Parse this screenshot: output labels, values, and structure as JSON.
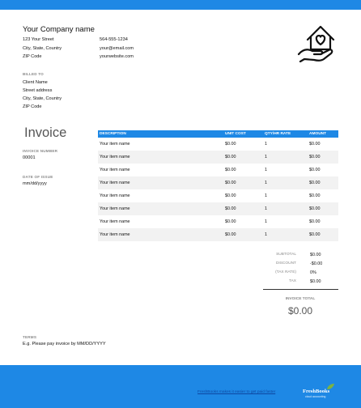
{
  "company": {
    "name": "Your Company name",
    "address_lines": [
      "123 Your Street",
      "City, State, Country",
      "ZIP Code"
    ],
    "contact_lines": [
      "564-555-1234",
      "your@email.com",
      "yourwebsite.com"
    ]
  },
  "billed_to": {
    "label": "BILLED TO",
    "lines": [
      "Client Name",
      "Street address",
      "City, State, Country",
      "ZIP Code"
    ]
  },
  "invoice": {
    "title": "Invoice",
    "number_label": "INVOICE NUMBER",
    "number": "00001",
    "date_label": "DATE OF ISSUE",
    "date": "mm/dd/yyyy"
  },
  "table": {
    "headers": [
      "DESCRIPTION",
      "UNIT COST",
      "QTY/HR RATE",
      "AMOUNT"
    ],
    "rows": [
      [
        "Your item name",
        "$0.00",
        "1",
        "$0.00"
      ],
      [
        "Your item name",
        "$0.00",
        "1",
        "$0.00"
      ],
      [
        "Your item name",
        "$0.00",
        "1",
        "$0.00"
      ],
      [
        "Your item name",
        "$0.00",
        "1",
        "$0.00"
      ],
      [
        "Your item name",
        "$0.00",
        "1",
        "$0.00"
      ],
      [
        "Your item name",
        "$0.00",
        "1",
        "$0.00"
      ],
      [
        "Your item name",
        "$0.00",
        "1",
        "$0.00"
      ],
      [
        "Your item name",
        "$0.00",
        "1",
        "$0.00"
      ]
    ]
  },
  "summary": {
    "subtotal_label": "SUBTOTAL",
    "subtotal": "$0.00",
    "discount_label": "DISCOUNT",
    "discount": "-$0.00",
    "taxrate_label": "(TAX RATE)",
    "taxrate": "0%",
    "tax_label": "TAX",
    "tax": "$0.00",
    "total_label": "INVOICE TOTAL",
    "total": "$0.00"
  },
  "terms": {
    "label": "TERMS",
    "text": "E.g. Please pay invoice by MM/DD/YYYY"
  },
  "footer": {
    "link_text": "FreshBooks makes it easier to get paid faster",
    "brand": "FreshBooks",
    "tagline": "cloud accounting"
  },
  "colors": {
    "accent": "#1e88e5",
    "leaf": "#7cb342"
  },
  "icons": {
    "logo": "house-heart-in-hand-icon"
  }
}
